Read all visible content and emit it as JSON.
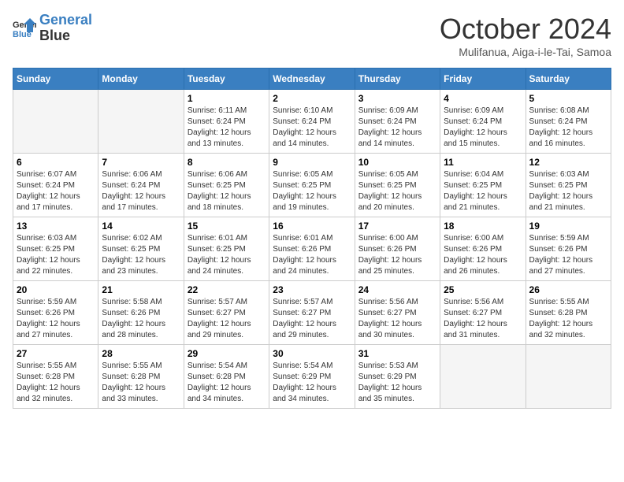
{
  "header": {
    "logo_line1": "General",
    "logo_line2": "Blue",
    "month": "October 2024",
    "location": "Mulifanua, Aiga-i-le-Tai, Samoa"
  },
  "days_of_week": [
    "Sunday",
    "Monday",
    "Tuesday",
    "Wednesday",
    "Thursday",
    "Friday",
    "Saturday"
  ],
  "weeks": [
    [
      {
        "day": "",
        "info": ""
      },
      {
        "day": "",
        "info": ""
      },
      {
        "day": "1",
        "info": "Sunrise: 6:11 AM\nSunset: 6:24 PM\nDaylight: 12 hours and 13 minutes."
      },
      {
        "day": "2",
        "info": "Sunrise: 6:10 AM\nSunset: 6:24 PM\nDaylight: 12 hours and 14 minutes."
      },
      {
        "day": "3",
        "info": "Sunrise: 6:09 AM\nSunset: 6:24 PM\nDaylight: 12 hours and 14 minutes."
      },
      {
        "day": "4",
        "info": "Sunrise: 6:09 AM\nSunset: 6:24 PM\nDaylight: 12 hours and 15 minutes."
      },
      {
        "day": "5",
        "info": "Sunrise: 6:08 AM\nSunset: 6:24 PM\nDaylight: 12 hours and 16 minutes."
      }
    ],
    [
      {
        "day": "6",
        "info": "Sunrise: 6:07 AM\nSunset: 6:24 PM\nDaylight: 12 hours and 17 minutes."
      },
      {
        "day": "7",
        "info": "Sunrise: 6:06 AM\nSunset: 6:24 PM\nDaylight: 12 hours and 17 minutes."
      },
      {
        "day": "8",
        "info": "Sunrise: 6:06 AM\nSunset: 6:25 PM\nDaylight: 12 hours and 18 minutes."
      },
      {
        "day": "9",
        "info": "Sunrise: 6:05 AM\nSunset: 6:25 PM\nDaylight: 12 hours and 19 minutes."
      },
      {
        "day": "10",
        "info": "Sunrise: 6:05 AM\nSunset: 6:25 PM\nDaylight: 12 hours and 20 minutes."
      },
      {
        "day": "11",
        "info": "Sunrise: 6:04 AM\nSunset: 6:25 PM\nDaylight: 12 hours and 21 minutes."
      },
      {
        "day": "12",
        "info": "Sunrise: 6:03 AM\nSunset: 6:25 PM\nDaylight: 12 hours and 21 minutes."
      }
    ],
    [
      {
        "day": "13",
        "info": "Sunrise: 6:03 AM\nSunset: 6:25 PM\nDaylight: 12 hours and 22 minutes."
      },
      {
        "day": "14",
        "info": "Sunrise: 6:02 AM\nSunset: 6:25 PM\nDaylight: 12 hours and 23 minutes."
      },
      {
        "day": "15",
        "info": "Sunrise: 6:01 AM\nSunset: 6:25 PM\nDaylight: 12 hours and 24 minutes."
      },
      {
        "day": "16",
        "info": "Sunrise: 6:01 AM\nSunset: 6:26 PM\nDaylight: 12 hours and 24 minutes."
      },
      {
        "day": "17",
        "info": "Sunrise: 6:00 AM\nSunset: 6:26 PM\nDaylight: 12 hours and 25 minutes."
      },
      {
        "day": "18",
        "info": "Sunrise: 6:00 AM\nSunset: 6:26 PM\nDaylight: 12 hours and 26 minutes."
      },
      {
        "day": "19",
        "info": "Sunrise: 5:59 AM\nSunset: 6:26 PM\nDaylight: 12 hours and 27 minutes."
      }
    ],
    [
      {
        "day": "20",
        "info": "Sunrise: 5:59 AM\nSunset: 6:26 PM\nDaylight: 12 hours and 27 minutes."
      },
      {
        "day": "21",
        "info": "Sunrise: 5:58 AM\nSunset: 6:26 PM\nDaylight: 12 hours and 28 minutes."
      },
      {
        "day": "22",
        "info": "Sunrise: 5:57 AM\nSunset: 6:27 PM\nDaylight: 12 hours and 29 minutes."
      },
      {
        "day": "23",
        "info": "Sunrise: 5:57 AM\nSunset: 6:27 PM\nDaylight: 12 hours and 29 minutes."
      },
      {
        "day": "24",
        "info": "Sunrise: 5:56 AM\nSunset: 6:27 PM\nDaylight: 12 hours and 30 minutes."
      },
      {
        "day": "25",
        "info": "Sunrise: 5:56 AM\nSunset: 6:27 PM\nDaylight: 12 hours and 31 minutes."
      },
      {
        "day": "26",
        "info": "Sunrise: 5:55 AM\nSunset: 6:28 PM\nDaylight: 12 hours and 32 minutes."
      }
    ],
    [
      {
        "day": "27",
        "info": "Sunrise: 5:55 AM\nSunset: 6:28 PM\nDaylight: 12 hours and 32 minutes."
      },
      {
        "day": "28",
        "info": "Sunrise: 5:55 AM\nSunset: 6:28 PM\nDaylight: 12 hours and 33 minutes."
      },
      {
        "day": "29",
        "info": "Sunrise: 5:54 AM\nSunset: 6:28 PM\nDaylight: 12 hours and 34 minutes."
      },
      {
        "day": "30",
        "info": "Sunrise: 5:54 AM\nSunset: 6:29 PM\nDaylight: 12 hours and 34 minutes."
      },
      {
        "day": "31",
        "info": "Sunrise: 5:53 AM\nSunset: 6:29 PM\nDaylight: 12 hours and 35 minutes."
      },
      {
        "day": "",
        "info": ""
      },
      {
        "day": "",
        "info": ""
      }
    ]
  ]
}
